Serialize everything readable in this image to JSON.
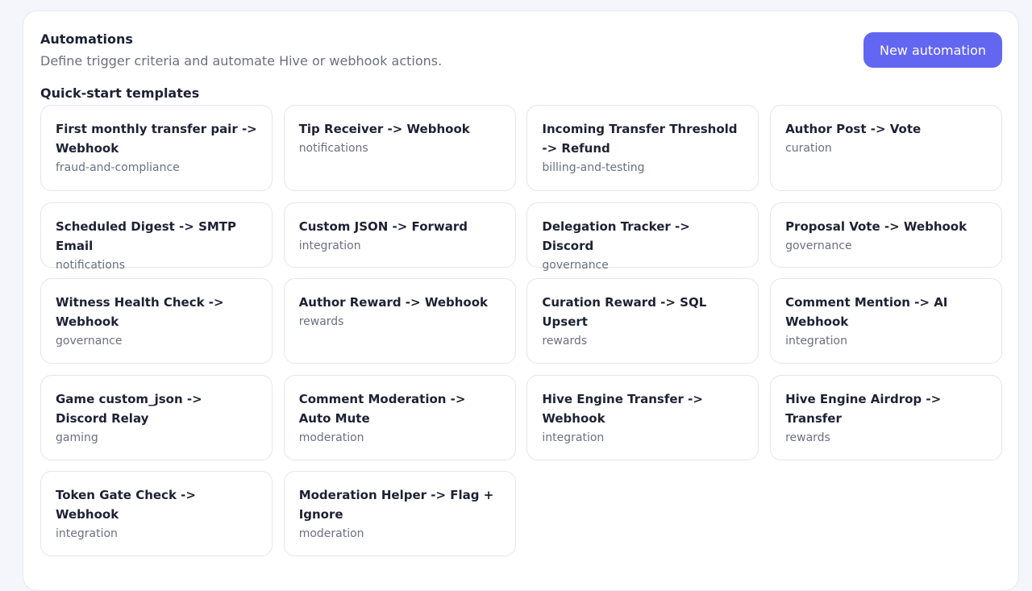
{
  "header": {
    "title": "Automations",
    "subtitle": "Define trigger criteria and automate Hive or webhook actions.",
    "new_button_label": "New automation"
  },
  "colors": {
    "accent": "#6366f1",
    "text": "#1d2233",
    "muted": "#6b7080",
    "border": "#e3e6ee"
  },
  "templates": {
    "title": "Quick-start templates",
    "items": [
      {
        "title": "First monthly transfer pair -> Webhook",
        "tag": "fraud-and-compliance"
      },
      {
        "title": "Tip Receiver -> Webhook",
        "tag": "notifications"
      },
      {
        "title": "Incoming Transfer Threshold -> Refund",
        "tag": "billing-and-testing"
      },
      {
        "title": "Author Post -> Vote",
        "tag": "curation"
      },
      {
        "title": "Scheduled Digest -> SMTP Email",
        "tag": "notifications"
      },
      {
        "title": "Custom JSON -> Forward",
        "tag": "integration"
      },
      {
        "title": "Delegation Tracker -> Discord",
        "tag": "governance"
      },
      {
        "title": "Proposal Vote -> Webhook",
        "tag": "governance"
      },
      {
        "title": "Witness Health Check -> Webhook",
        "tag": "governance"
      },
      {
        "title": "Author Reward -> Webhook",
        "tag": "rewards"
      },
      {
        "title": "Curation Reward -> SQL Upsert",
        "tag": "rewards"
      },
      {
        "title": "Comment Mention -> AI Webhook",
        "tag": "integration"
      },
      {
        "title": "Game custom_json -> Discord Relay",
        "tag": "gaming"
      },
      {
        "title": "Comment Moderation -> Auto Mute",
        "tag": "moderation"
      },
      {
        "title": "Hive Engine Transfer -> Webhook",
        "tag": "integration"
      },
      {
        "title": "Hive Engine Airdrop -> Transfer",
        "tag": "rewards"
      },
      {
        "title": "Token Gate Check -> Webhook",
        "tag": "integration"
      },
      {
        "title": "Moderation Helper -> Flag + Ignore",
        "tag": "moderation"
      }
    ]
  }
}
